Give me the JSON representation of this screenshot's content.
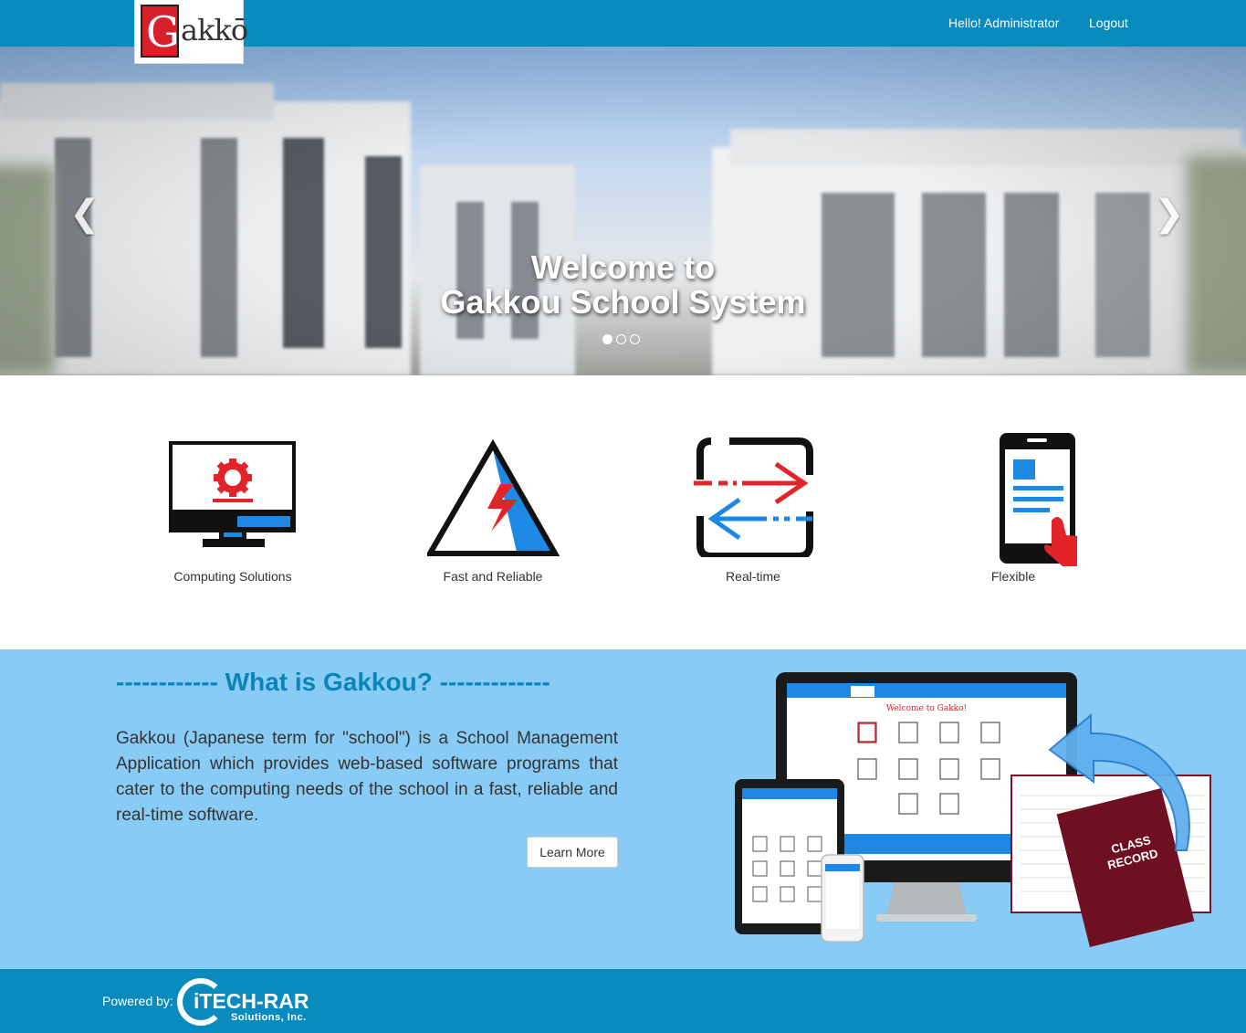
{
  "header": {
    "logo_initial": "G",
    "logo_rest": "akkō",
    "greeting": "Hello! Administrator",
    "logout_label": "Logout"
  },
  "hero": {
    "title_line1": "Welcome to",
    "title_line2": "Gakkou School System",
    "prev_icon": "chevron-left-icon",
    "next_icon": "chevron-right-icon",
    "slide_count": 3,
    "active_slide": 1
  },
  "features": [
    {
      "label": "Computing Solutions",
      "icon": "monitor-gear-icon"
    },
    {
      "label": "Fast and Reliable",
      "icon": "lightning-triangle-icon"
    },
    {
      "label": "Real-time",
      "icon": "sync-arrows-icon"
    },
    {
      "label": "Flexible",
      "icon": "mobile-touch-icon"
    }
  ],
  "about": {
    "title": "------------ What is Gakkou? -------------",
    "description": "Gakkou (Japanese term for \"school\") is a School Management Application which provides web-based software programs that cater to the computing needs of the school in a fast, reliable and real-time software.",
    "button_label": "Learn More",
    "illustration": {
      "screen_title": "Welcome to Gakko!",
      "record_label_line1": "CLASS",
      "record_label_line2": "RECORD"
    }
  },
  "footer": {
    "powered_by": "Powered by:",
    "company_name": "iTECH-RAR",
    "company_sub": "Solutions, Inc."
  },
  "colors": {
    "primary": "#0a8bbd",
    "about_bg": "#88cbf5",
    "title_blue": "#0a85b8",
    "accent_red": "#e2232a",
    "accent_blue": "#1e88e5"
  }
}
